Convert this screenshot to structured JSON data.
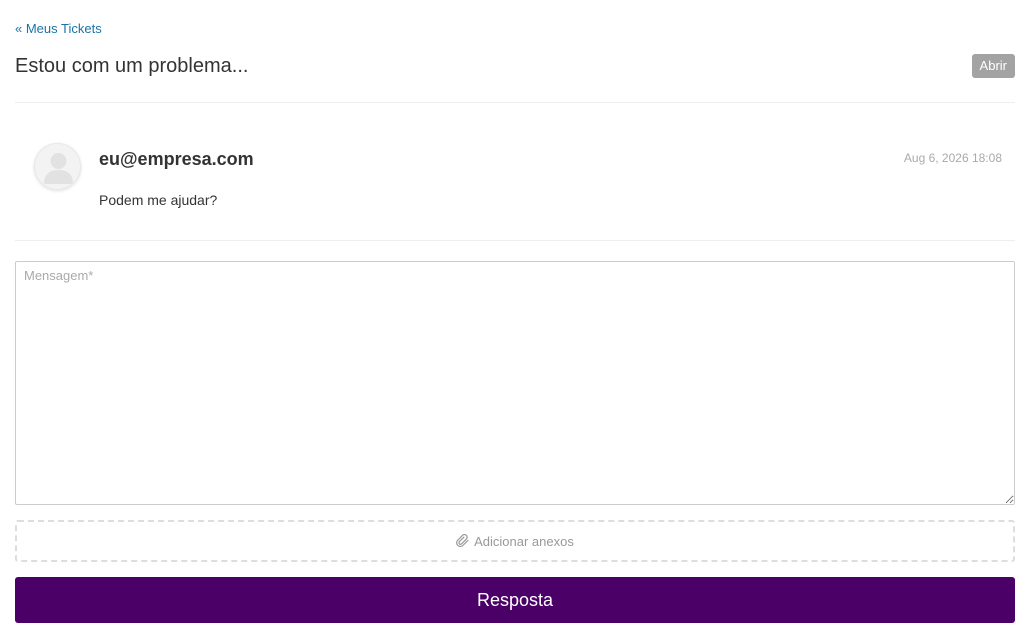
{
  "nav": {
    "back_link_label": "« Meus Tickets"
  },
  "ticket": {
    "title": "Estou com um problema...",
    "status_label": "Abrir"
  },
  "messages": [
    {
      "author": "eu@empresa.com",
      "date": "Aug 6, 2026 18:08",
      "body": "Podem me ajudar?",
      "avatar_icon": "user-avatar-icon"
    }
  ],
  "reply_form": {
    "message_placeholder": "Mensagem*",
    "message_value": "",
    "attach_label": "Adicionar anexos",
    "attach_icon": "paperclip-icon",
    "submit_label": "Resposta"
  },
  "colors": {
    "link": "#1a73a8",
    "badge": "#a3a3a3",
    "primary_button": "#4a0066"
  }
}
